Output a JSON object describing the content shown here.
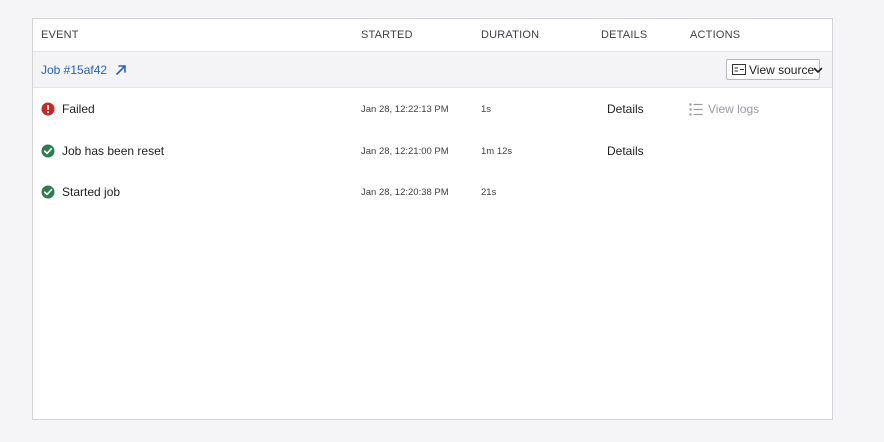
{
  "columns": {
    "event": "EVENT",
    "started": "STARTED",
    "duration": "DURATION",
    "details": "DETAILS",
    "actions": "ACTIONS"
  },
  "job": {
    "label": "Job #15af42",
    "view_source_label": "View source",
    "link_icon": "external-link-arrow-icon",
    "source_icon": "source-icon",
    "expand_icon": "chevron-down-icon"
  },
  "events": [
    {
      "status": "error",
      "label": "Failed",
      "started": "Jan 28, 12:22:13 PM",
      "duration": "1s",
      "details": "Details",
      "action": "View logs"
    },
    {
      "status": "success",
      "label": "Job has been reset",
      "started": "Jan 28, 12:21:00 PM",
      "duration": "1m 12s",
      "details": "Details",
      "action": ""
    },
    {
      "status": "success",
      "label": "Started job",
      "started": "Jan 28, 12:20:38 PM",
      "duration": "21s",
      "details": "",
      "action": ""
    }
  ],
  "colors": {
    "error": "#c62828",
    "success": "#2e7d4f",
    "link": "#2563b8"
  }
}
